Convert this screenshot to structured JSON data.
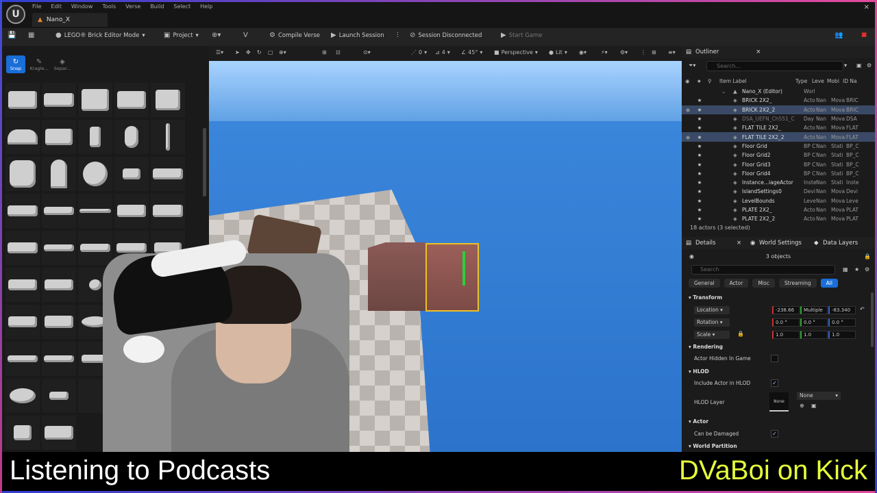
{
  "window": {
    "logo": "U",
    "menus": [
      "File",
      "Edit",
      "Window",
      "Tools",
      "Verse",
      "Build",
      "Select",
      "Help"
    ],
    "doc_tab": "Nano_X",
    "close": "×"
  },
  "toolbar": {
    "mode": "LEGO® Brick Editor Mode",
    "project": "Project",
    "compile": "Compile Verse",
    "launch": "Launch Session",
    "session_status": "Session Disconnected",
    "start_game": "Start Game"
  },
  "left_panel": {
    "modes": [
      {
        "label": "Snap",
        "icon": "↻",
        "active": true
      },
      {
        "label": "Kragle...",
        "icon": "✎",
        "active": false
      },
      {
        "label": "Separ...",
        "icon": "◈",
        "active": false
      }
    ]
  },
  "viewport": {
    "perspective": "Perspective",
    "lit": "Lit",
    "angle": "45°",
    "snap_num": "0",
    "grid_num": "4"
  },
  "outliner": {
    "title": "Outliner",
    "search_placeholder": "Search...",
    "columns": {
      "label": "Item Label",
      "type": "Type",
      "level": "Leve",
      "mobility": "Mobi",
      "id": "ID Na"
    },
    "root": "Nano_X (Editor)",
    "root_type": "Worl",
    "rows": [
      {
        "label": "BRICK 2X2_",
        "type": "Acto",
        "level": "Nan",
        "mob": "Mova",
        "id": "BRIC",
        "sel": false,
        "dim": false
      },
      {
        "label": "BRICK 2X2_2",
        "type": "Acto",
        "level": "Nan",
        "mob": "Mova",
        "id": "BRIC",
        "sel": true,
        "dim": false
      },
      {
        "label": "DSA_UEFN_Ch551_C",
        "type": "Day",
        "level": "Nan",
        "mob": "Mova",
        "id": "DSA",
        "sel": false,
        "dim": true
      },
      {
        "label": "FLAT TILE 2X2_",
        "type": "Acto",
        "level": "Nan",
        "mob": "Mova",
        "id": "FLAT",
        "sel": false,
        "dim": false
      },
      {
        "label": "FLAT TILE 2X2_2",
        "type": "Acto",
        "level": "Nan",
        "mob": "Mova",
        "id": "FLAT",
        "sel": true,
        "dim": false
      },
      {
        "label": "Floor Grid",
        "type": "BP C",
        "level": "Nan",
        "mob": "Stati",
        "id": "BP_C",
        "sel": false,
        "dim": false
      },
      {
        "label": "Floor Grid2",
        "type": "BP C",
        "level": "Nan",
        "mob": "Stati",
        "id": "BP_C",
        "sel": false,
        "dim": false
      },
      {
        "label": "Floor Grid3",
        "type": "BP C",
        "level": "Nan",
        "mob": "Stati",
        "id": "BP_C",
        "sel": false,
        "dim": false
      },
      {
        "label": "Floor Grid4",
        "type": "BP C",
        "level": "Nan",
        "mob": "Stati",
        "id": "BP_C",
        "sel": false,
        "dim": false
      },
      {
        "label": "Instance...iageActor",
        "type": "Inste",
        "level": "Nan",
        "mob": "Stati",
        "id": "Inste",
        "sel": false,
        "dim": false
      },
      {
        "label": "IslandSettings0",
        "type": "Devi",
        "level": "Nan",
        "mob": "Mova",
        "id": "Devi",
        "sel": false,
        "dim": false
      },
      {
        "label": "LevelBounds",
        "type": "Leve",
        "level": "Nan",
        "mob": "Mova",
        "id": "Leve",
        "sel": false,
        "dim": false
      },
      {
        "label": "PLATE 2X2_",
        "type": "Acto",
        "level": "Nan",
        "mob": "Mova",
        "id": "PLAT",
        "sel": false,
        "dim": false
      },
      {
        "label": "PLATE 2X2_2",
        "type": "Acto",
        "level": "Nan",
        "mob": "Mova",
        "id": "PLAT",
        "sel": false,
        "dim": false
      }
    ],
    "actor_count": "18 actors (3 selected)"
  },
  "details": {
    "tab": "Details",
    "world_settings": "World Settings",
    "data_layers": "Data Layers",
    "objects": "3 objects",
    "search_placeholder": "Search",
    "filters": [
      "General",
      "Actor",
      "Misc",
      "Streaming",
      "All"
    ],
    "transform": "Transform",
    "location": "Location",
    "location_vals": [
      "-238.66",
      "Multiple",
      "-83.340"
    ],
    "rotation": "Rotation",
    "rotation_vals": [
      "0.0 °",
      "0.0 °",
      "0.0 °"
    ],
    "scale": "Scale",
    "scale_vals": [
      "1.0",
      "1.0",
      "1.0"
    ],
    "rendering": "Rendering",
    "hidden_in_game": "Actor Hidden In Game",
    "hlod": "HLOD",
    "include_in_hlod": "Include Actor in HLOD",
    "hlod_layer": "HLOD Layer",
    "hlod_layer_thumb": "None",
    "hlod_layer_value": "None",
    "actor": "Actor",
    "can_be_damaged": "Can be Damaged",
    "world_partition": "World Partition"
  },
  "captions": {
    "left": "Listening to Podcasts",
    "right": "DVaBoi on Kick"
  },
  "colors": {
    "accent": "#1a6ed8",
    "caption_right": "#e5ff3a",
    "selection": "#3a4a66"
  }
}
